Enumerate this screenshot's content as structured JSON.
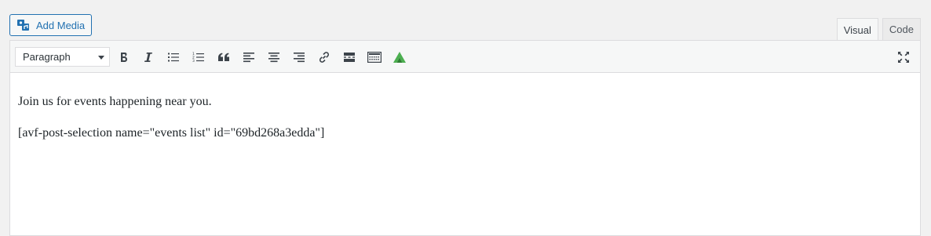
{
  "add_media": {
    "label": "Add Media"
  },
  "tabs": [
    {
      "label": "Visual",
      "active": true
    },
    {
      "label": "Code",
      "active": false
    }
  ],
  "toolbar": {
    "format_value": "Paragraph",
    "buttons": [
      "bold-icon",
      "italic-icon",
      "bulleted-list-icon",
      "numbered-list-icon",
      "blockquote-icon",
      "align-left-icon",
      "align-center-icon",
      "align-right-icon",
      "link-icon",
      "read-more-icon",
      "toolbar-toggle-icon",
      "brand-logo-icon",
      "fullscreen-icon"
    ]
  },
  "content": {
    "paragraphs": [
      "Join us for events happening near you.",
      "[avf-post-selection name=\"events list\" id=\"69bd268a3edda\"]"
    ]
  },
  "colors": {
    "accent": "#2271b1",
    "brand_logo": "#4caf50"
  }
}
